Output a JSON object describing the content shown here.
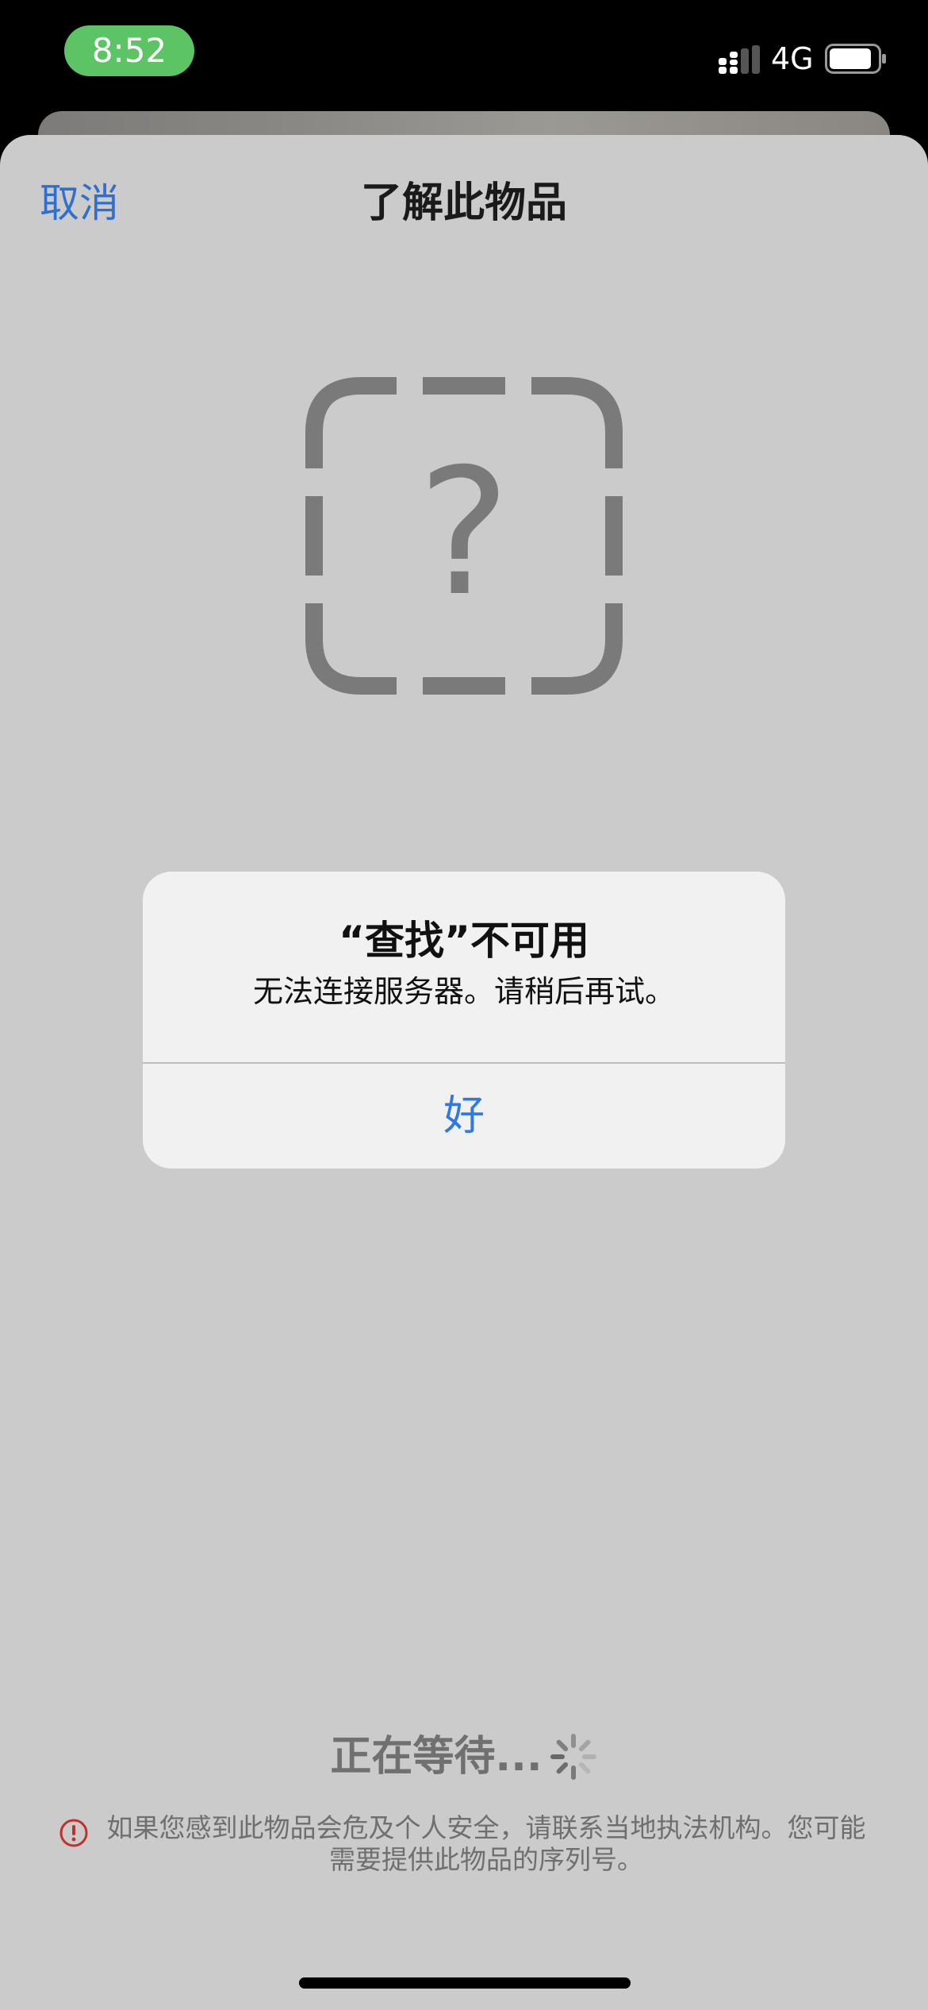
{
  "status_bar": {
    "time": "8:52",
    "network": "4G",
    "colors": {
      "time_pill": "#5dc466"
    }
  },
  "nav": {
    "cancel_label": "取消",
    "title": "了解此物品"
  },
  "item_icon": {
    "name": "question-mark-dashed-square-icon",
    "glyph": "?"
  },
  "alert": {
    "title": "“查找”不可用",
    "message": "无法连接服务器。请稍后再试。",
    "ok_label": "好"
  },
  "waiting": {
    "label": "正在等待..."
  },
  "safety_note": {
    "text": "如果您感到此物品会危及个人安全，请联系当地执法机构。您可能需要提供此物品的序列号。"
  },
  "colors": {
    "accent_blue": "#2f6fcf",
    "sheet_background": "#cbcbcb",
    "warning_red": "#c0302c"
  }
}
